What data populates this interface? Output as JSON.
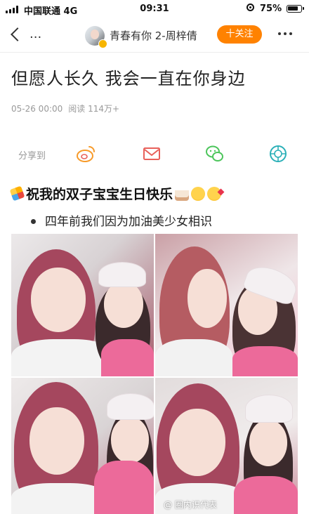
{
  "status_bar": {
    "carrier": "中国联通  4G",
    "time": "09:31",
    "battery": "75%"
  },
  "nav": {
    "ellipsis": "...",
    "account_name": "青春有你 2-周梓倩",
    "follow_label": "十关注"
  },
  "article": {
    "title": "但愿人长久  我会一直在你身边",
    "date": "05-26 00:00",
    "reads": "阅读 114万+"
  },
  "share": {
    "label": "分享到",
    "targets": [
      "weibo-icon",
      "mail-icon",
      "wechat-icon",
      "moments-icon"
    ]
  },
  "content": {
    "birthday_text": "祝我的双子宝宝生日快乐",
    "bullet": "四年前我们因为加油美少女相识"
  },
  "watermark": "@ 圈内识代表",
  "colors": {
    "follow_orange": "#ff8200",
    "weibo_orange": "#f79a2a",
    "mail_red": "#e8605a",
    "wechat_green": "#4cc55b",
    "moments_teal": "#2bb0b8"
  }
}
